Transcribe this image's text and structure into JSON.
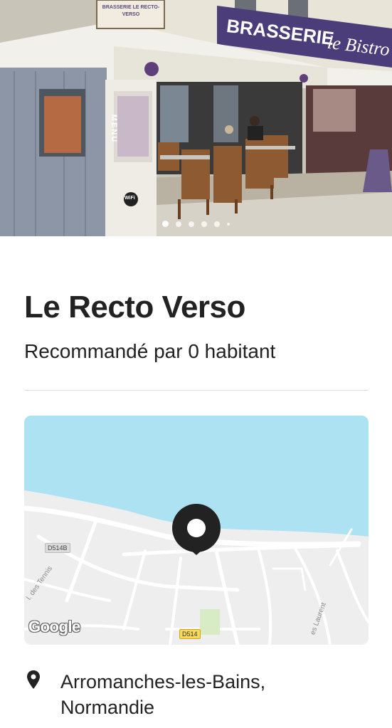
{
  "hero": {
    "sign_brasserie": "BRASSERIE",
    "sign_bistro": "le Bistro",
    "sign_menu": "MENU",
    "sign_wifi": "WiFi",
    "sign_top": "BRASSERIE LE RECTO-VERSO",
    "carousel": {
      "count": 6,
      "active_index": 0
    }
  },
  "place": {
    "title": "Le Recto Verso",
    "subtitle": "Recommandé par 0 habitant"
  },
  "map": {
    "road_d514b": "D514B",
    "road_d514": "D514",
    "street_tennis": "l. des Tennis",
    "street_laurent": "es Laurent",
    "google": "Google",
    "colors": {
      "sea": "#ade2f2",
      "land": "#eeeeee",
      "roads": "#ffffff",
      "pin": "#222222"
    }
  },
  "address": {
    "icon": "location-pin-icon",
    "line1": "Arromanches-les-Bains,",
    "line2": "Normandie"
  }
}
